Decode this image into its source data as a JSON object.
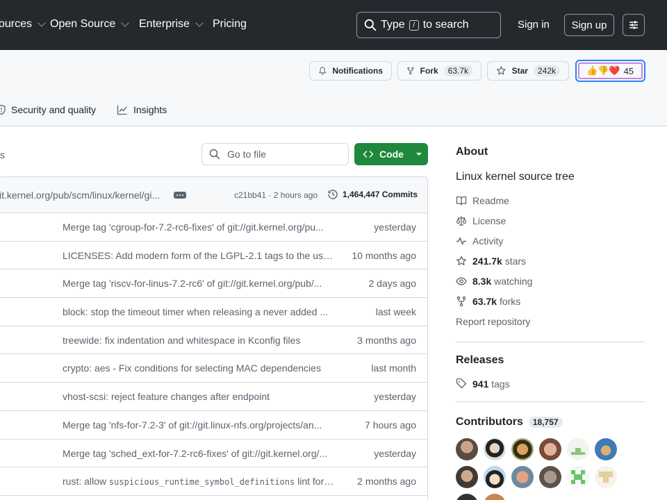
{
  "nav": {
    "items": [
      "ources",
      "Open Source",
      "Enterprise",
      "Pricing"
    ],
    "search_text_pre": "Type",
    "search_key": "/",
    "search_text_post": "to search",
    "sign_in": "Sign in",
    "sign_up": "Sign up"
  },
  "repo_actions": {
    "notifications": "Notifications",
    "fork": "Fork",
    "fork_count": "63.7k",
    "star": "Star",
    "star_count": "242k",
    "reactions_count": "45",
    "reactions_emoji": "👍👎❤️"
  },
  "tabs": {
    "security": "Security and quality",
    "insights": "Insights"
  },
  "files": {
    "branch_fragment": "s",
    "go_to_file": "Go to file",
    "code": "Code",
    "latest_commit": "it.kernel.org/pub/scm/linux/kernel/gi...",
    "latest_hash": "c21bb41 · 2 hours ago",
    "commit_count": "1,464,447 Commits",
    "rows": [
      {
        "msg": "Merge tag 'cgroup-for-7.2-rc6-fixes' of git://git.kernel.org/pu...",
        "time": "yesterday"
      },
      {
        "msg": "LICENSES: Add modern form of the LGPL-2.1 tags to the usag...",
        "time": "10 months ago"
      },
      {
        "msg": "Merge tag 'riscv-for-linus-7.2-rc6' of git://git.kernel.org/pub/...",
        "time": "2 days ago"
      },
      {
        "msg": "block: stop the timeout timer when releasing a never added ...",
        "time": "last week"
      },
      {
        "msg": "treewide: fix indentation and whitespace in Kconfig files",
        "time": "3 months ago"
      },
      {
        "msg": "crypto: aes - Fix conditions for selecting MAC dependencies",
        "time": "last month"
      },
      {
        "msg": "vhost-scsi: reject feature changes after endpoint",
        "time": "yesterday"
      },
      {
        "msg": "Merge tag 'nfs-for-7.2-3' of git://git.linux-nfs.org/projects/an...",
        "time": "7 hours ago"
      },
      {
        "msg": "Merge tag 'sched_ext-for-7.2-rc6-fixes' of git://git.kernel.org/...",
        "time": "yesterday"
      },
      {
        "msg_pre": "rust: allow ",
        "msg_code": "suspicious_runtime_symbol_definitions",
        "msg_post": " lint for Ru...",
        "time": "2 months ago"
      }
    ]
  },
  "about": {
    "heading": "About",
    "description": "Linux kernel source tree",
    "readme": "Readme",
    "license": "License",
    "activity": "Activity",
    "stars_num": "241.7k",
    "stars_label": "stars",
    "watching_num": "8.3k",
    "watching_label": "watching",
    "forks_num": "63.7k",
    "forks_label": "forks",
    "report": "Report repository"
  },
  "releases": {
    "heading": "Releases",
    "tags_num": "941",
    "tags_label": "tags"
  },
  "contributors": {
    "heading": "Contributors",
    "count": "18,757"
  },
  "colors": {
    "nav_bg": "#25292e",
    "code_button": "#1f883d",
    "focus_ring": "#2f81f7"
  }
}
